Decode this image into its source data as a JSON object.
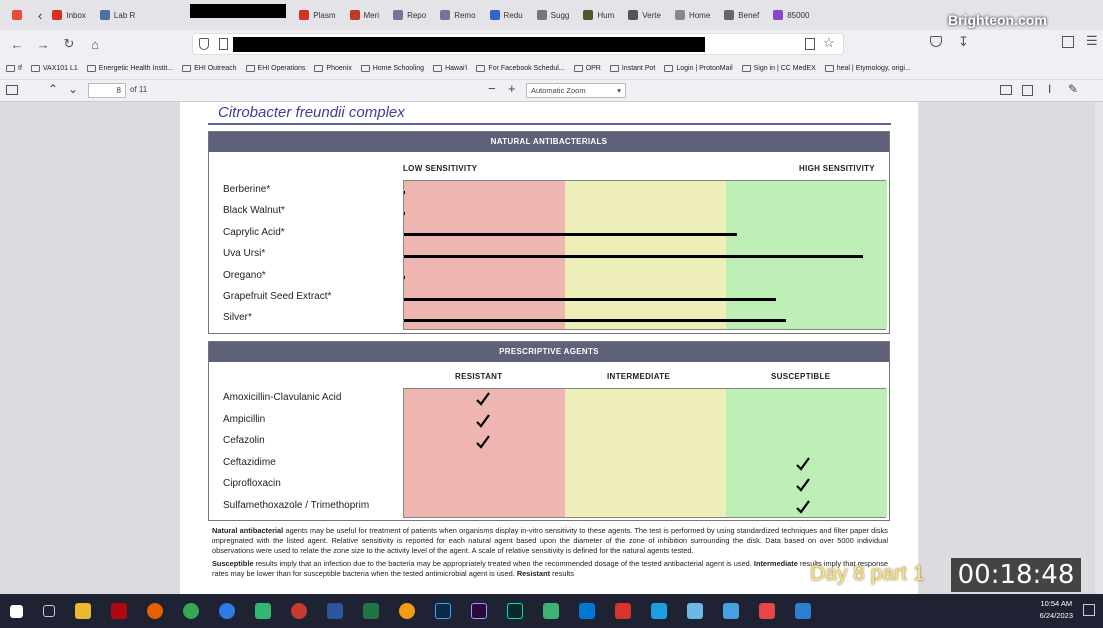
{
  "tabs": [
    {
      "label": "",
      "color": "#e74c3c"
    },
    {
      "label": "Inbox",
      "color": "#d93025"
    },
    {
      "label": "Lab R",
      "color": "#4a6fa5"
    },
    {
      "label": "Plasm",
      "color": "#d93025"
    },
    {
      "label": "Meri",
      "color": "#c0392b"
    },
    {
      "label": "Repo",
      "color": "#7b6f9e"
    },
    {
      "label": "Remo",
      "color": "#7b6f9e"
    },
    {
      "label": "Redu",
      "color": "#3366cc"
    },
    {
      "label": "Sugg",
      "color": "#777"
    },
    {
      "label": "Hum",
      "color": "#4a5a2a"
    },
    {
      "label": "Verte",
      "color": "#555"
    },
    {
      "label": "Home",
      "color": "#888"
    },
    {
      "label": "Benef",
      "color": "#666"
    },
    {
      "label": "85000",
      "color": "#8844cc"
    }
  ],
  "brand": "Brighteon.com",
  "bookmarks": [
    "If",
    "VAX101 L1",
    "Energetic Health Instit...",
    "EHI Outreach",
    "EHI Operations",
    "Phoenix",
    "Home Schooling",
    "Hawai'i",
    "For Facebook Schedul...",
    "OPR",
    "Instant Pot",
    "Login | ProtonMail",
    "Sign in | CC MedEX",
    "heal | Etymology, origi..."
  ],
  "pdf_toolbar": {
    "page": "8",
    "of": "of 11",
    "zoom": "Automatic Zoom"
  },
  "report": {
    "organism": "Citrobacter freundii complex",
    "natural": {
      "heading": "NATURAL ANTIBACTERIALS",
      "low_label": "LOW SENSITIVITY",
      "high_label": "HIGH SENSITIVITY",
      "zone_colors": [
        "#eeb5b1",
        "#eeeeb9",
        "#bdeeb6"
      ],
      "rows": [
        {
          "name": "Berberine*",
          "level": 0
        },
        {
          "name": "Black Walnut*",
          "level": 0
        },
        {
          "name": "Caprylic Acid*",
          "level": 0.69
        },
        {
          "name": "Uva Ursi*",
          "level": 0.95
        },
        {
          "name": "Oregano*",
          "level": 0
        },
        {
          "name": "Grapefruit Seed Extract*",
          "level": 0.77
        },
        {
          "name": "Silver*",
          "level": 0.79
        }
      ]
    },
    "prescriptive": {
      "heading": "PRESCRIPTIVE AGENTS",
      "columns": [
        "RESISTANT",
        "INTERMEDIATE",
        "SUSCEPTIBLE"
      ],
      "rows": [
        {
          "name": "Amoxicillin-Clavulanic Acid",
          "result": "RESISTANT"
        },
        {
          "name": "Ampicillin",
          "result": "RESISTANT"
        },
        {
          "name": "Cefazolin",
          "result": "RESISTANT"
        },
        {
          "name": "Ceftazidime",
          "result": "SUSCEPTIBLE"
        },
        {
          "name": "Ciprofloxacin",
          "result": "SUSCEPTIBLE"
        },
        {
          "name": "Sulfamethoxazole / Trimethoprim",
          "result": "SUSCEPTIBLE"
        }
      ]
    },
    "footnote_natural_bold": "Natural antibacterial",
    "footnote_natural": " agents may be useful for treatment of patients when organisms display in-vitro sensitivity to these agents. The test is performed by using standardized techniques and filter paper disks impregnated with the listed agent. Relative sensitivity is reported for each natural agent based upon the diameter of the zone of inhibition surrounding the disk. Data based on over 5000 individual observations were used to relate the zone size to the activity level of the agent. A scale of relative sensitivity is defined for the natural agents tested.",
    "footnote_susc_bold": "Susceptible",
    "footnote_susc": " results imply that an infection due to the bacteria may be appropriately treated when the recommended dosage of the tested antibacterial agent is used. ",
    "footnote_inter_bold": "Intermediate",
    "footnote_inter": " results imply that response rates may be lower than for susceptible bacteria when the tested antimicrobial agent is used. ",
    "footnote_res_bold": "Resistant",
    "footnote_res": " results"
  },
  "overlay": {
    "episode": "Day 8 part 1",
    "timer": "00:18:48"
  },
  "clock": {
    "time": "10:54 AM",
    "date": "6/24/2023"
  }
}
